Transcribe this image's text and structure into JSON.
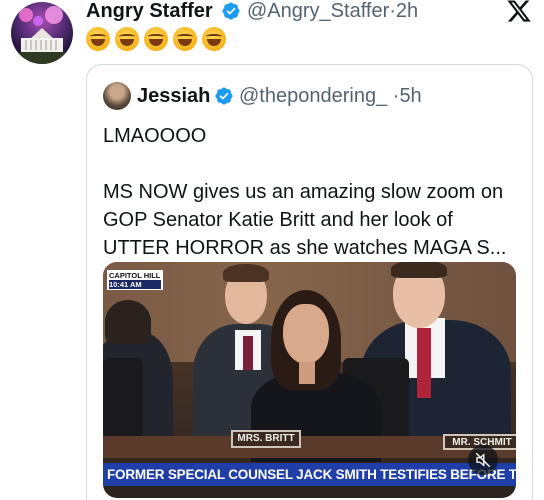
{
  "author": {
    "name": "Angry Staffer",
    "handle": "@Angry_Staffer",
    "separator": "·",
    "time": "2h",
    "verified": true,
    "avatar": "white-house-fireworks-avatar"
  },
  "brand": {
    "logo": "x-logo-icon"
  },
  "post": {
    "emojis": [
      "rolling-on-floor-laughing",
      "rolling-on-floor-laughing",
      "rolling-on-floor-laughing",
      "rolling-on-floor-laughing",
      "rolling-on-floor-laughing"
    ]
  },
  "quote": {
    "name": "Jessiah",
    "handle": "@thepondering_",
    "separator": "·",
    "time": "5h",
    "verified": true,
    "text_line1": "LMAOOOO",
    "text_body": "MS NOW gives us an amazing slow zoom on GOP Senator Katie Britt and her look of UTTER HORROR as she watches MAGA S...",
    "media": {
      "chyron_location": "CAPITOL HILL",
      "chyron_time": "10:41 AM",
      "nameplate_center": "MRS. BRITT",
      "nameplate_right": "MR. SCHMIT",
      "ticker": "FORMER SPECIAL COUNSEL JACK SMITH TESTIFIES BEFORE THE SENATE",
      "mute_icon": "muted-speaker-icon"
    }
  },
  "colors": {
    "text": "#0f1419",
    "secondary": "#536471",
    "verified": "#1d9bf0",
    "border": "#cfd9de",
    "ticker": "#1f3ea8"
  }
}
